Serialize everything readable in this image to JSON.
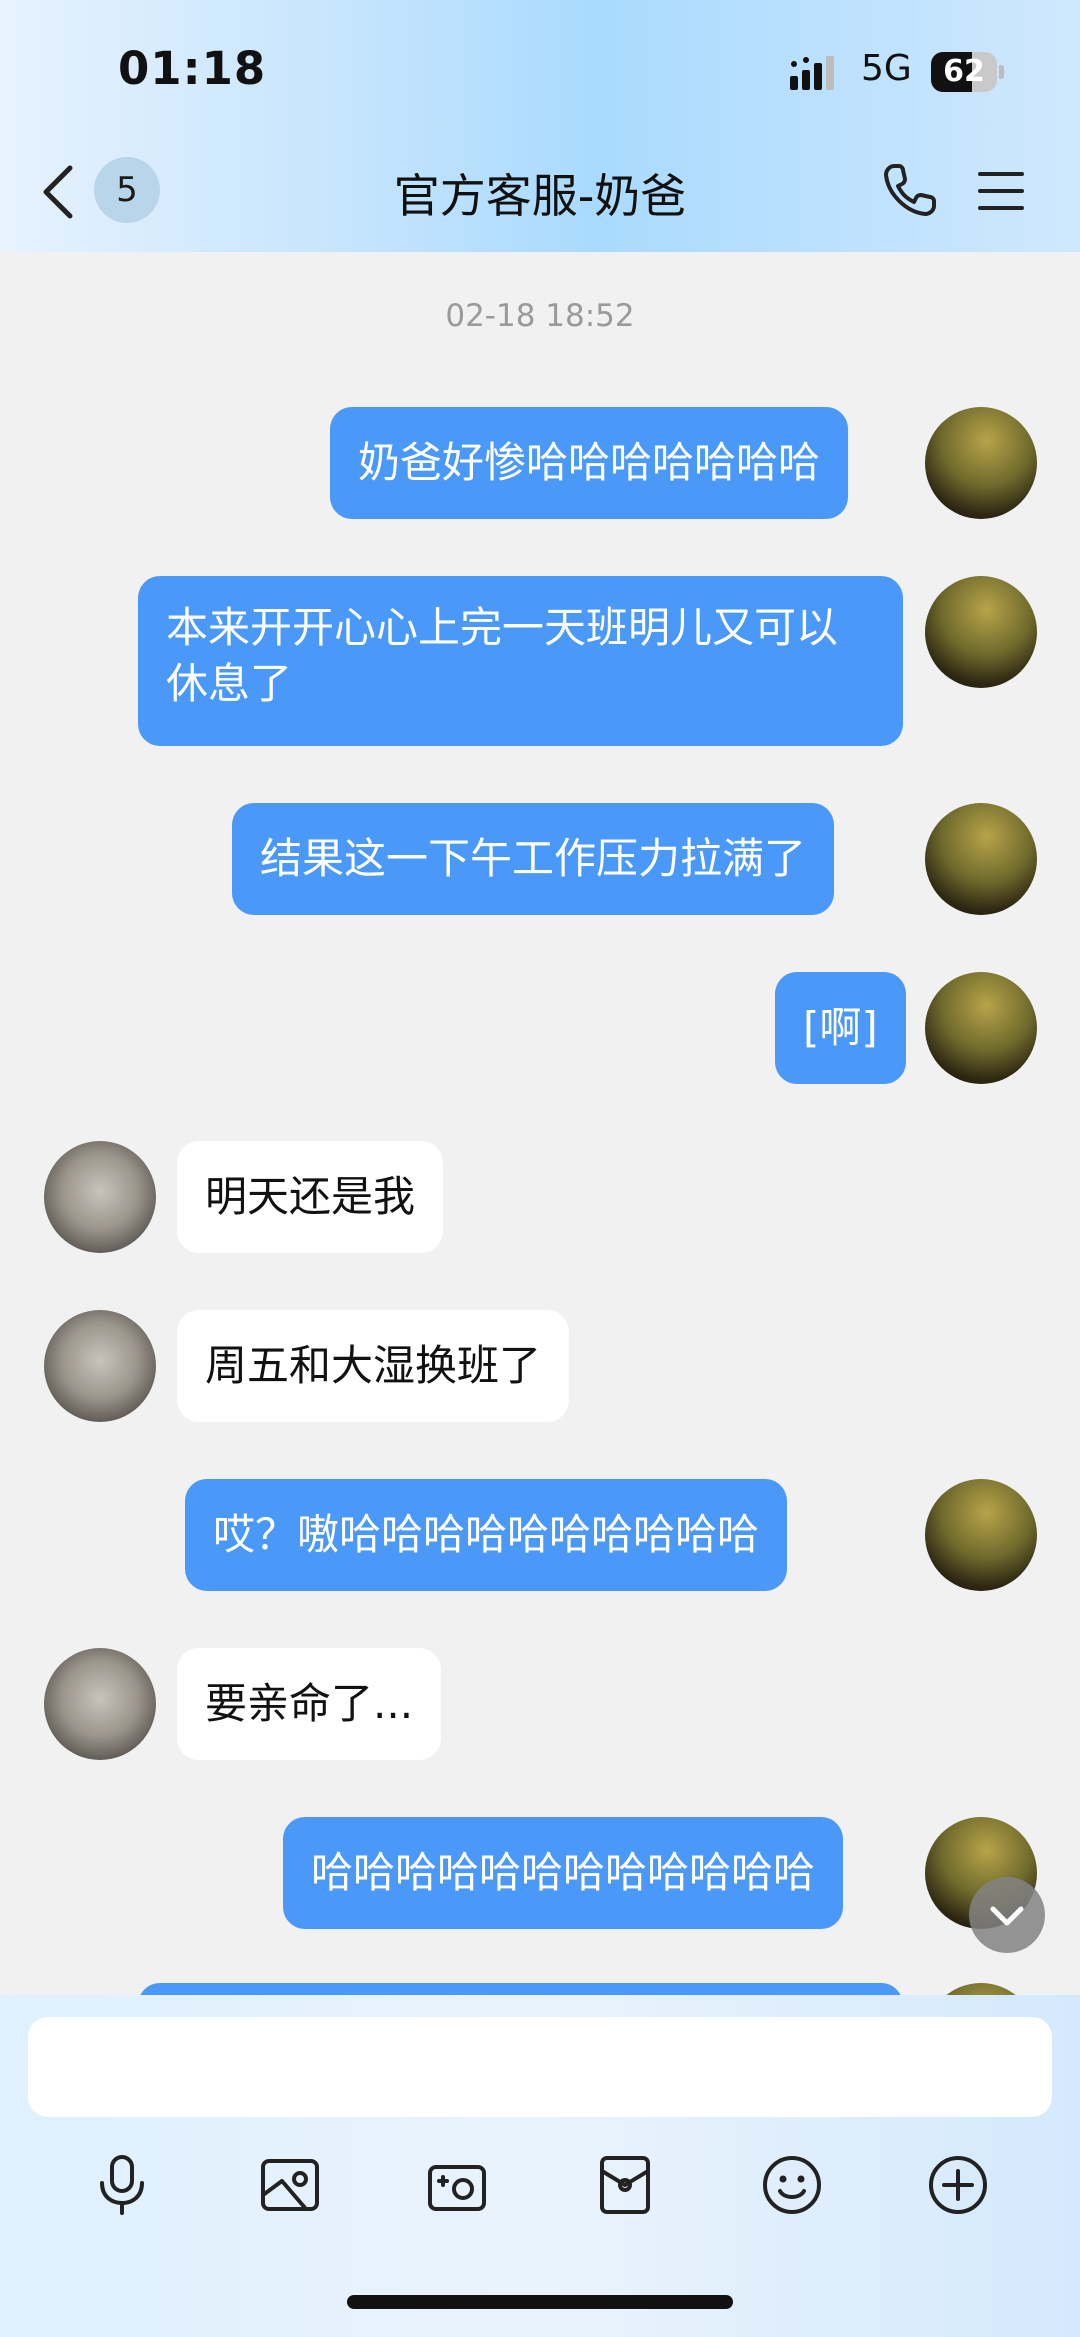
{
  "status_bar": {
    "time": "01:18",
    "network": "5G",
    "battery_level": "62",
    "battery_fraction": 0.62
  },
  "header": {
    "back_icon": "chevron-left-icon",
    "unread_count": "5",
    "title": "官方客服-奶爸",
    "call_icon": "phone-icon",
    "menu_icon": "menu-icon"
  },
  "chat": {
    "timestamp": "02-18 18:52",
    "messages": [
      {
        "side": "out",
        "sender_avatar": "avatar-man",
        "text": "奶爸好惨哈哈哈哈哈哈哈"
      },
      {
        "side": "out",
        "sender_avatar": "avatar-man",
        "text": "本来开开心心上完一天班明儿又可以休息了"
      },
      {
        "side": "out",
        "sender_avatar": "avatar-man",
        "text": "结果这一下午工作压力拉满了"
      },
      {
        "side": "out",
        "sender_avatar": "avatar-man",
        "text": "[啊]"
      },
      {
        "side": "in",
        "sender_avatar": "avatar-cat",
        "text": "明天还是我"
      },
      {
        "side": "in",
        "sender_avatar": "avatar-cat",
        "text": "周五和大湿换班了"
      },
      {
        "side": "out",
        "sender_avatar": "avatar-man",
        "text": "哎？嗷哈哈哈哈哈哈哈哈哈哈"
      },
      {
        "side": "in",
        "sender_avatar": "avatar-cat",
        "text": "要亲命了..."
      },
      {
        "side": "out",
        "sender_avatar": "avatar-man",
        "text": "哈哈哈哈哈哈哈哈哈哈哈哈"
      }
    ]
  },
  "composer": {
    "input_value": "",
    "tools": [
      "microphone-icon",
      "photo-icon",
      "camera-icon",
      "red-packet-icon",
      "emoji-icon",
      "plus-icon"
    ]
  },
  "colors": {
    "outgoing_bubble": "#4a98f7",
    "incoming_bubble": "#ffffff",
    "background": "#f1f1f1"
  }
}
